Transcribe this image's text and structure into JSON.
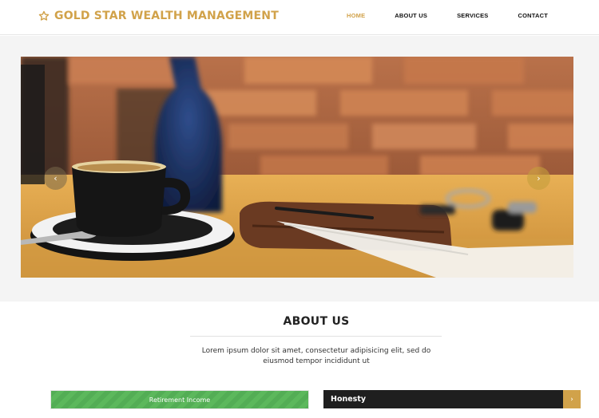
{
  "brand": {
    "name": "GOLD STAR WEALTH MANAGEMENT",
    "color": "#d1a24a"
  },
  "nav": {
    "items": [
      {
        "label": "HOME",
        "active": true
      },
      {
        "label": "ABOUT US",
        "active": false
      },
      {
        "label": "SERVICES",
        "active": false
      },
      {
        "label": "CONTACT",
        "active": false
      }
    ]
  },
  "carousel": {
    "prev_icon": "chevron-left-icon",
    "next_icon": "chevron-right-icon",
    "prev_glyph": "‹",
    "next_glyph": "›"
  },
  "about": {
    "title": "ABOUT US",
    "text": "Lorem ipsum dolor sit amet, consectetur adipisicing elit, sed do eiusmod tempor incididunt ut"
  },
  "skill_bar": {
    "label": "Retirement Income",
    "fill_fraction": 1.0,
    "color": "#5cb85c"
  },
  "accordion": {
    "title": "Honesty",
    "toggle_icon": "chevron-right-icon",
    "toggle_glyph": "›"
  }
}
